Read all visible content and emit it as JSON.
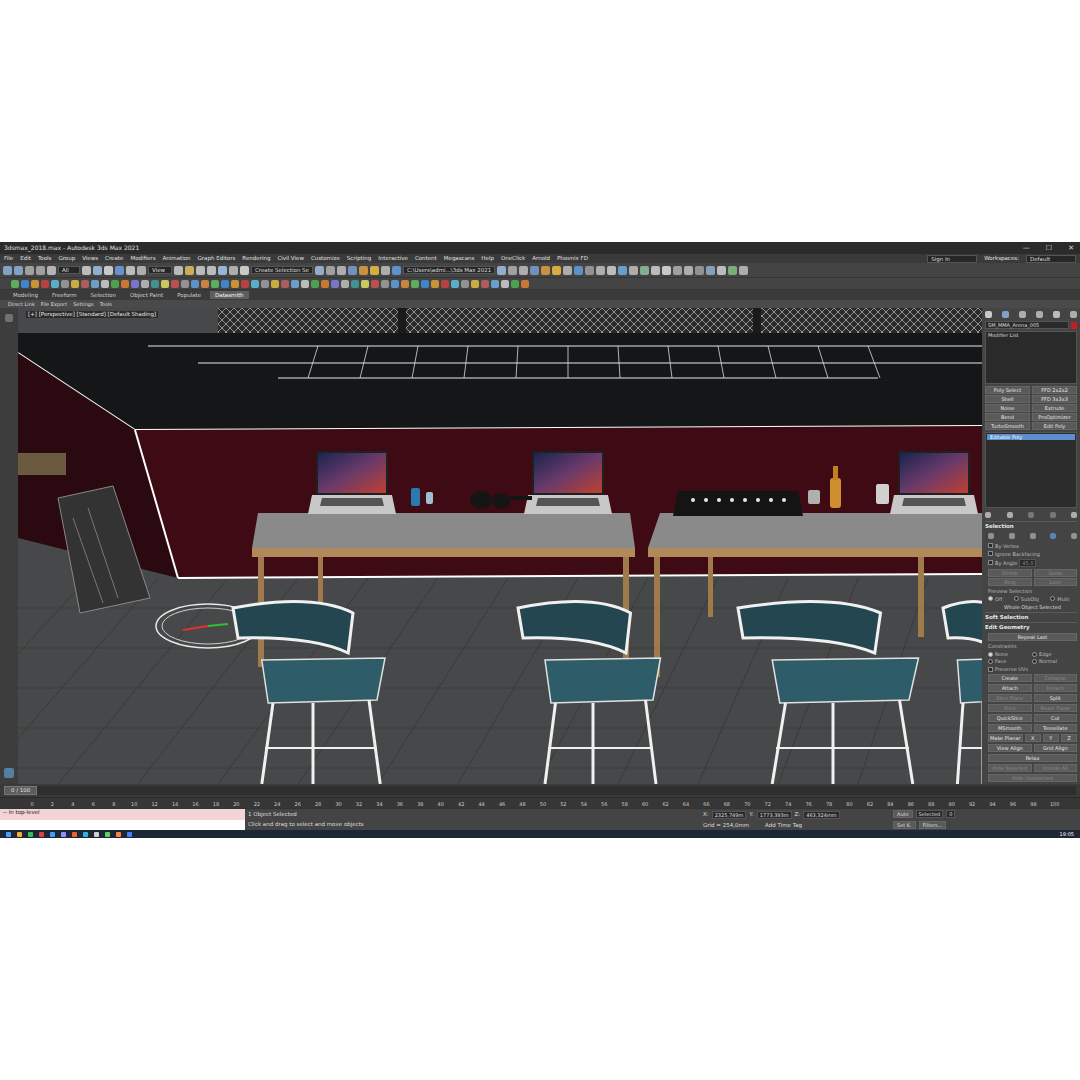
{
  "window": {
    "title": "3dsmax_2018.max - Autodesk 3ds Max 2021",
    "controls": [
      "—",
      "☐",
      "✕"
    ]
  },
  "menu": [
    "File",
    "Edit",
    "Tools",
    "Group",
    "Views",
    "Create",
    "Modifiers",
    "Animation",
    "Graph Editors",
    "Rendering",
    "Civil View",
    "Customize",
    "Scripting",
    "Interactive",
    "Content",
    "Megascans",
    "Help",
    "OneClick",
    "Arnold",
    "Phoenix FD"
  ],
  "account": {
    "sign_in": "Sign In",
    "workspaces_label": "Workspaces:",
    "workspace": "Default"
  },
  "toolbar": {
    "filter": "All",
    "coord_system": "View",
    "selection_set": "Create Selection Se",
    "project_path": "C:\\Users\\admi...\\3ds Max 2021"
  },
  "ribbon_tabs": [
    {
      "label": "Modeling",
      "selected": false
    },
    {
      "label": "Freeform",
      "selected": false
    },
    {
      "label": "Selection",
      "selected": false
    },
    {
      "label": "Object Paint",
      "selected": false
    },
    {
      "label": "Populate",
      "selected": false
    },
    {
      "label": "Datasmith",
      "selected": true
    }
  ],
  "ribbon_items": [
    "Direct Link",
    "File Export",
    "Settings",
    "Tools"
  ],
  "viewport": {
    "label": "[+] [Perspective] [Standard] [Default Shading]"
  },
  "command_panel": {
    "object_name": "SM_MMA_Arena_005",
    "modifier_list": "Modifier List",
    "modifier_buttons": [
      "Poly Select",
      "FFD 2x2x2",
      "Shell",
      "FFD 3x3x3",
      "Noise",
      "Extrude",
      "Bend",
      "ProOptimizer",
      "TurboSmooth",
      "Edit Poly"
    ],
    "stack": [
      {
        "label": "Editable Poly",
        "selected": true
      }
    ],
    "selection": {
      "title": "Selection",
      "checks": [
        {
          "label": "By Vertex",
          "checked": false
        },
        {
          "label": "Ignore Backfacing",
          "checked": false
        },
        {
          "label": "By Angle",
          "checked": false
        }
      ],
      "angle": "45,0",
      "buttons": [
        "Shrink",
        "Grow",
        "Ring",
        "Loop"
      ],
      "preview_label": "Preview Selection",
      "preview_options": [
        {
          "label": "Off",
          "selected": true
        },
        {
          "label": "SubObj",
          "selected": false
        },
        {
          "label": "Multi",
          "selected": false
        }
      ],
      "info": "Whole Object Selected"
    },
    "soft_selection": {
      "title": "Soft Selection"
    },
    "edit_geometry": {
      "title": "Edit Geometry",
      "repeat": "Repeat Last",
      "constraints_label": "Constraints",
      "constraints": [
        {
          "label": "None",
          "selected": true
        },
        {
          "label": "Edge",
          "selected": false
        },
        {
          "label": "Face",
          "selected": false
        },
        {
          "label": "Normal",
          "selected": false
        }
      ],
      "preserve_uvs": {
        "label": "Preserve UVs",
        "checked": false
      },
      "button_rows": [
        [
          {
            "label": "Create",
            "disabled": false
          },
          {
            "label": "Collapse",
            "disabled": true
          }
        ],
        [
          {
            "label": "Attach",
            "disabled": false
          },
          {
            "label": "Detach",
            "disabled": true
          }
        ],
        [
          {
            "label": "Slice Plane",
            "disabled": true
          },
          {
            "label": "Split",
            "disabled": false
          }
        ],
        [
          {
            "label": "Slice",
            "disabled": true
          },
          {
            "label": "Reset Plane",
            "disabled": true
          }
        ],
        [
          {
            "label": "QuickSlice",
            "disabled": false
          },
          {
            "label": "Cut",
            "disabled": false
          }
        ],
        [
          {
            "label": "MSmooth",
            "disabled": false
          },
          {
            "label": "Tessellate",
            "disabled": false
          }
        ],
        [
          {
            "label": "Make Planar",
            "disabled": false
          },
          {
            "label": "X",
            "disabled": false
          },
          {
            "label": "Y",
            "disabled": false
          },
          {
            "label": "Z",
            "disabled": false
          }
        ],
        [
          {
            "label": "View Align",
            "disabled": false
          },
          {
            "label": "Grid Align",
            "disabled": false
          }
        ],
        [
          {
            "label": "Relax",
            "disabled": false
          }
        ],
        [
          {
            "label": "Hide Selected",
            "disabled": true
          },
          {
            "label": "Unhide All",
            "disabled": true
          }
        ],
        [
          {
            "label": "Hide Unselected",
            "disabled": true
          }
        ]
      ]
    }
  },
  "timeline": {
    "frame": "0 / 100",
    "level": 0,
    "ticks": [
      "0",
      "2",
      "4",
      "6",
      "8",
      "10",
      "12",
      "14",
      "16",
      "18",
      "20",
      "22",
      "24",
      "26",
      "28",
      "30",
      "32",
      "34",
      "36",
      "38",
      "40",
      "42",
      "44",
      "46",
      "48",
      "50",
      "52",
      "54",
      "56",
      "58",
      "60",
      "62",
      "64",
      "66",
      "68",
      "70",
      "72",
      "74",
      "76",
      "78",
      "80",
      "82",
      "84",
      "86",
      "88",
      "90",
      "92",
      "94",
      "96",
      "98",
      "100"
    ]
  },
  "status": {
    "maxscript": "-- In top-level",
    "selected_count": "1 Object Selected",
    "prompt": "Click and drag to select and move objects",
    "x_label": "X:",
    "x": "2325,749m",
    "y_label": "Y:",
    "y": "1773,393m",
    "z_label": "Z:",
    "z": "463,324mm",
    "grid": "Grid = 254,0mm",
    "add_time_tag": "Add Time Tag",
    "auto": "Auto",
    "set_key": "Set K.",
    "key_filter": "Selected",
    "filters": "Filters...",
    "frame": "0"
  },
  "taskbar": {
    "time": "19:05"
  }
}
